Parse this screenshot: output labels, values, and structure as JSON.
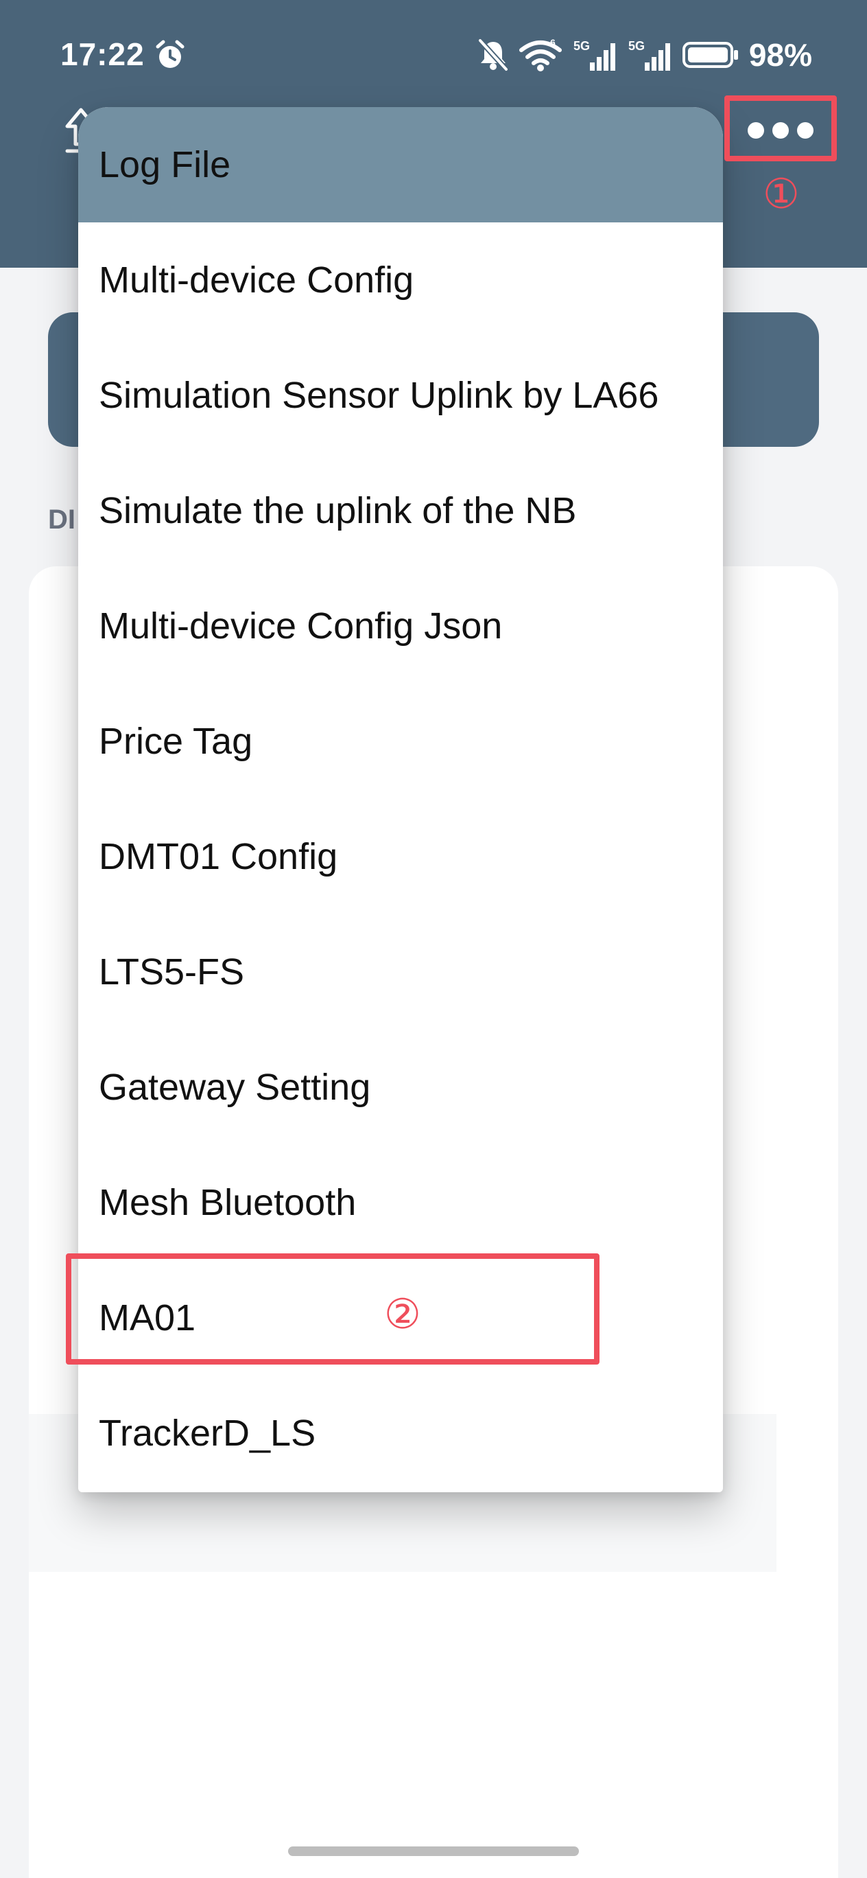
{
  "status_bar": {
    "time": "17:22",
    "battery": "98%",
    "network_labels": [
      "6",
      "5G",
      "5G"
    ]
  },
  "header": {
    "more_icon": "more-horizontal-icon"
  },
  "background": {
    "section_label": "DI"
  },
  "menu": {
    "items": [
      {
        "label": "Log File"
      },
      {
        "label": "Multi-device Config"
      },
      {
        "label": "Simulation Sensor Uplink by LA66"
      },
      {
        "label": "Simulate the uplink of the NB"
      },
      {
        "label": "Multi-device Config Json"
      },
      {
        "label": "Price Tag"
      },
      {
        "label": "DMT01 Config"
      },
      {
        "label": "LTS5-FS"
      },
      {
        "label": "Gateway Setting"
      },
      {
        "label": "Mesh Bluetooth"
      },
      {
        "label": "MA01"
      },
      {
        "label": "TrackerD_LS"
      }
    ]
  },
  "annotations": {
    "one": "①",
    "two": "②"
  },
  "colors": {
    "header": "#4a6479",
    "menu_active": "#7390a2",
    "annotation": "#ef4e5b"
  }
}
